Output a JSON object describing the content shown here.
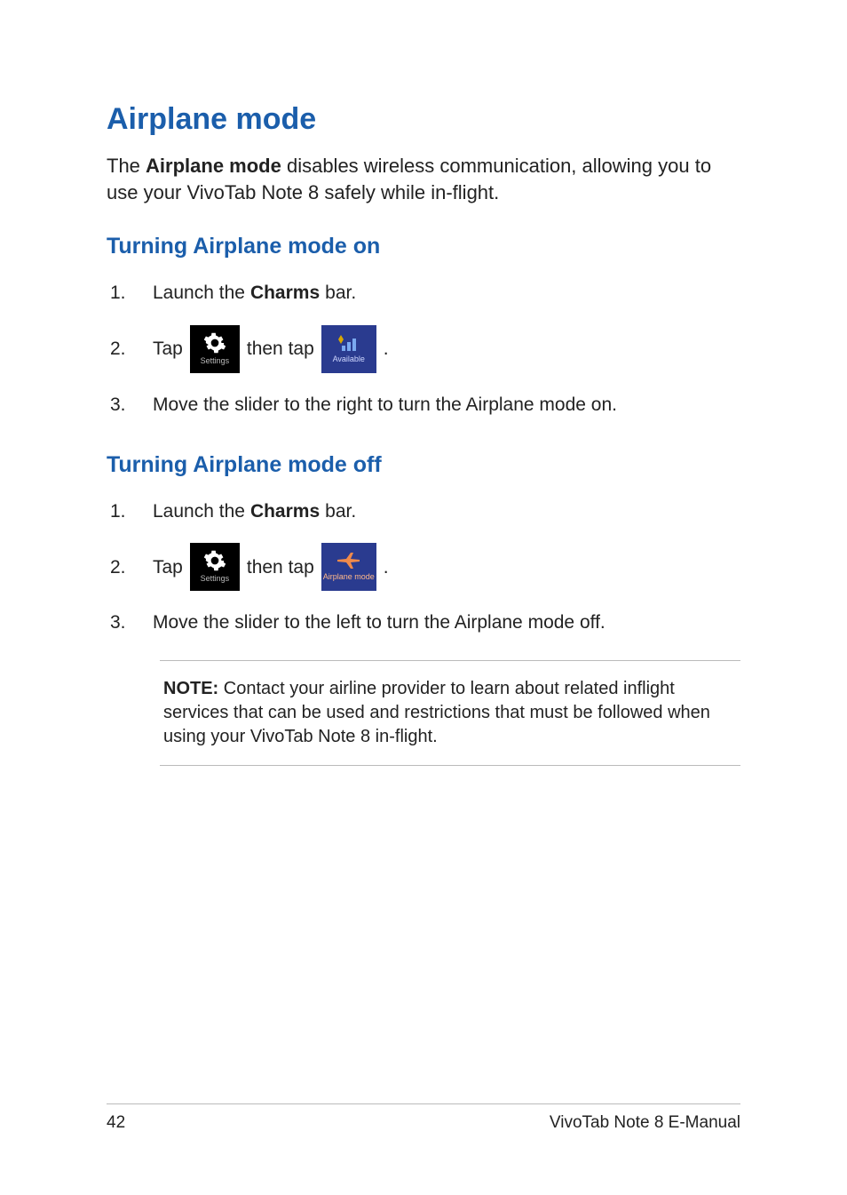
{
  "heading": "Airplane mode",
  "intro": {
    "pre": "The ",
    "bold": "Airplane mode",
    "post": " disables wireless communication, allowing you to use your VivoTab Note 8 safely while in-flight."
  },
  "section_on": {
    "heading": "Turning Airplane mode on",
    "steps": {
      "s1": {
        "num": "1.",
        "pre": "Launch the ",
        "bold": "Charms",
        "post": " bar."
      },
      "s2": {
        "num": "2.",
        "pre": "Tap",
        "mid": "then tap",
        "period": "."
      },
      "s3": {
        "num": "3.",
        "text": "Move the slider to the right to turn the Airplane mode on."
      }
    }
  },
  "section_off": {
    "heading": "Turning Airplane mode off",
    "steps": {
      "s1": {
        "num": "1.",
        "pre": "Launch the ",
        "bold": "Charms",
        "post": " bar."
      },
      "s2": {
        "num": "2.",
        "pre": "Tap",
        "mid": "then tap",
        "period": "."
      },
      "s3": {
        "num": "3.",
        "text": "Move the slider to the left to turn the Airplane mode off."
      }
    }
  },
  "icons": {
    "settings_label": "Settings",
    "available_label": "Available",
    "airplane_label": "Airplane mode"
  },
  "note": {
    "label": "NOTE:",
    "text": " Contact your airline provider to learn about related inflight services that can be used and restrictions that must be followed when using your VivoTab Note 8 in-flight."
  },
  "footer": {
    "page": "42",
    "title": "VivoTab Note 8 E-Manual"
  }
}
